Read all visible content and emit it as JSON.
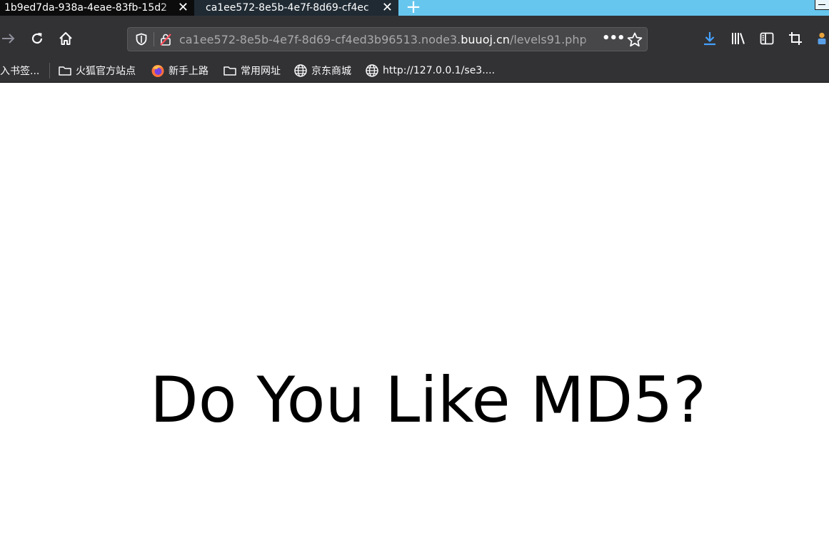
{
  "tabs": [
    {
      "title": "1b9ed7da-938a-4eae-83fb-15d2",
      "close": "✕"
    },
    {
      "title": "ca1ee572-8e5b-4e7f-8d69-cf4ec",
      "close": "✕"
    }
  ],
  "newtab_symbol": "+",
  "toolbar": {
    "back_icon": "arrow-right",
    "reload_icon": "reload",
    "home_icon": "home",
    "more_label": "•••"
  },
  "urlbar": {
    "prefix": "ca1ee572-8e5b-4e7f-8d69-cf4ed3b96513.node3.",
    "domain": "buuoj.cn",
    "path": "/levels91.php"
  },
  "bookmarks": [
    {
      "label": "入书签...",
      "icon": "none"
    },
    {
      "label": "火狐官方站点",
      "icon": "folder-icon"
    },
    {
      "label": "新手上路",
      "icon": "firefox-icon"
    },
    {
      "label": "常用网址",
      "icon": "folder-icon"
    },
    {
      "label": "京东商城",
      "icon": "globe-icon"
    },
    {
      "label": "http://127.0.0.1/se3....",
      "icon": "globe-icon"
    }
  ],
  "page": {
    "headline": "Do You Like MD5?"
  },
  "colors": {
    "tab_active": "#0c0c0d",
    "tab_inactive": "#1f2a33",
    "titlebar_accent": "#67c6ee",
    "toolbar": "#323234",
    "urlbar": "#474749",
    "download_accent": "#45a1ff"
  }
}
